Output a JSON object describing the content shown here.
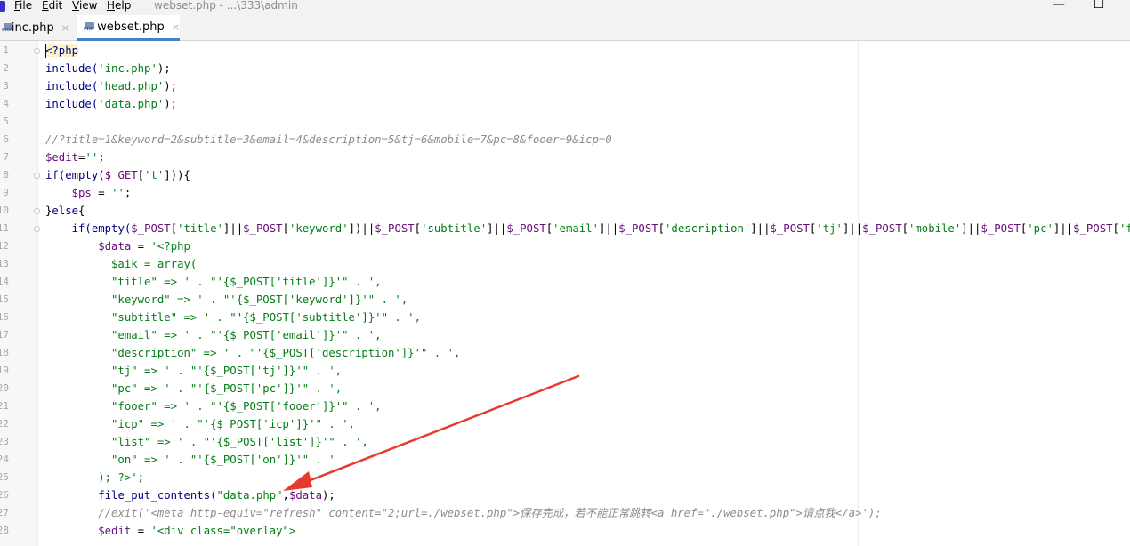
{
  "menubar": {
    "items": [
      "File",
      "Edit",
      "View",
      "Help"
    ],
    "title": "webset.php - ...\\333\\admin",
    "minimize": "—",
    "maximize": "☐"
  },
  "tabs": [
    {
      "label": "inc.php",
      "close": "×",
      "icon": "php-file-icon",
      "active": false
    },
    {
      "label": "webset.php",
      "close": "×",
      "icon": "php-file-icon",
      "active": true
    }
  ],
  "line_numbers": [
    "1",
    "2",
    "3",
    "4",
    "5",
    "6",
    "7",
    "8",
    "9",
    "10",
    "11",
    "12",
    "13",
    "14",
    "15",
    "16",
    "17",
    "18",
    "19",
    "20",
    "21",
    "22",
    "23",
    "24",
    "25",
    "26",
    "27",
    "28"
  ],
  "code": [
    [
      [
        "tag",
        "<?php"
      ]
    ],
    [
      [
        "k",
        "include("
      ],
      [
        "s",
        "'inc.php'"
      ],
      [
        "d",
        ");"
      ]
    ],
    [
      [
        "k",
        "include("
      ],
      [
        "s",
        "'head.php'"
      ],
      [
        "d",
        ");"
      ]
    ],
    [
      [
        "k",
        "include("
      ],
      [
        "s",
        "'data.php'"
      ],
      [
        "d",
        ");"
      ]
    ],
    [],
    [
      [
        "c",
        "//?title=1&keyword=2&subtitle=3&email=4&description=5&tj=6&mobile=7&pc=8&fooer=9&icp=0"
      ]
    ],
    [
      [
        "v",
        "$edit"
      ],
      [
        "d",
        "="
      ],
      [
        "s",
        "''"
      ],
      [
        "d",
        ";"
      ]
    ],
    [
      [
        "k",
        "if(empty("
      ],
      [
        "v",
        "$_GET"
      ],
      [
        "d",
        "["
      ],
      [
        "s",
        "'t'"
      ],
      [
        "d",
        "])){"
      ]
    ],
    [
      [
        "d",
        "    "
      ],
      [
        "v",
        "$ps"
      ],
      [
        "d",
        " = "
      ],
      [
        "s",
        "''"
      ],
      [
        "d",
        ";"
      ]
    ],
    [
      [
        "d",
        "}"
      ],
      [
        "k",
        "else"
      ],
      [
        "d",
        "{"
      ]
    ],
    [
      [
        "d",
        "    "
      ],
      [
        "k",
        "if(empty("
      ],
      [
        "v",
        "$_POST"
      ],
      [
        "d",
        "["
      ],
      [
        "s",
        "'title'"
      ],
      [
        "d",
        "]||"
      ],
      [
        "v",
        "$_POST"
      ],
      [
        "d",
        "["
      ],
      [
        "s",
        "'keyword'"
      ],
      [
        "d",
        "])||"
      ],
      [
        "v",
        "$_POST"
      ],
      [
        "d",
        "["
      ],
      [
        "s",
        "'subtitle'"
      ],
      [
        "d",
        "]||"
      ],
      [
        "v",
        "$_POST"
      ],
      [
        "d",
        "["
      ],
      [
        "s",
        "'email'"
      ],
      [
        "d",
        "]||"
      ],
      [
        "v",
        "$_POST"
      ],
      [
        "d",
        "["
      ],
      [
        "s",
        "'description'"
      ],
      [
        "d",
        "]||"
      ],
      [
        "v",
        "$_POST"
      ],
      [
        "d",
        "["
      ],
      [
        "s",
        "'tj'"
      ],
      [
        "d",
        "]||"
      ],
      [
        "v",
        "$_POST"
      ],
      [
        "d",
        "["
      ],
      [
        "s",
        "'mobile'"
      ],
      [
        "d",
        "]||"
      ],
      [
        "v",
        "$_POST"
      ],
      [
        "d",
        "["
      ],
      [
        "s",
        "'pc'"
      ],
      [
        "d",
        "]||"
      ],
      [
        "v",
        "$_POST"
      ],
      [
        "d",
        "["
      ],
      [
        "s",
        "'fooer'"
      ],
      [
        "d",
        "]"
      ]
    ],
    [
      [
        "d",
        "        "
      ],
      [
        "v",
        "$data"
      ],
      [
        "d",
        " = "
      ],
      [
        "s",
        "'<?php"
      ]
    ],
    [
      [
        "s",
        "          $aik = array("
      ]
    ],
    [
      [
        "s",
        "          \"title\" => ' . \"'{$_POST['title']}'\" . ',"
      ]
    ],
    [
      [
        "s",
        "          \"keyword\" => ' . \"'{$_POST['keyword']}'\" . ',"
      ]
    ],
    [
      [
        "s",
        "          \"subtitle\" => ' . \"'{$_POST['subtitle']}'\" . ',"
      ]
    ],
    [
      [
        "s",
        "          \"email\" => ' . \"'{$_POST['email']}'\" . ',"
      ]
    ],
    [
      [
        "s",
        "          \"description\" => ' . \"'{$_POST['description']}'\" . ',"
      ]
    ],
    [
      [
        "s",
        "          \"tj\" => ' . \"'{$_POST['tj']}'\" . ',"
      ]
    ],
    [
      [
        "s",
        "          \"pc\" => ' . \"'{$_POST['pc']}'\" . ',"
      ]
    ],
    [
      [
        "s",
        "          \"fooer\" => ' . \"'{$_POST['fooer']}'\" . ',"
      ]
    ],
    [
      [
        "s",
        "          \"icp\" => ' . \"'{$_POST['icp']}'\" . ',"
      ]
    ],
    [
      [
        "s",
        "          \"list\" => ' . \"'{$_POST['list']}'\" . ',"
      ]
    ],
    [
      [
        "s",
        "          \"on\" => ' . \"'{$_POST['on']}'\" . '"
      ]
    ],
    [
      [
        "s",
        "        ); ?>'"
      ],
      [
        "d",
        ";"
      ]
    ],
    [
      [
        "d",
        "        "
      ],
      [
        "k",
        "file_put_contents("
      ],
      [
        "s",
        "\"data.php\""
      ],
      [
        "d",
        ","
      ],
      [
        "v",
        "$data"
      ],
      [
        "d",
        ");"
      ]
    ],
    [
      [
        "d",
        "        "
      ],
      [
        "c",
        "//exit('<meta http-equiv=\"refresh\" content=\"2;url=./webset.php\">"
      ],
      [
        "cj",
        "保存完成，若不能正常跳转"
      ],
      [
        "c",
        "<a href=\"./webset.php\">"
      ],
      [
        "cj",
        "请点我"
      ],
      [
        "c",
        "</a>');"
      ]
    ],
    [
      [
        "d",
        "        "
      ],
      [
        "v",
        "$edit"
      ],
      [
        "d",
        " = "
      ],
      [
        "s",
        "'<div class=\"overlay\">"
      ]
    ]
  ],
  "annotation": {
    "color": "#e8392e",
    "label": "red-arrow"
  },
  "colors": {
    "keyword": "#000080",
    "string": "#067d17",
    "variable": "#660e7a",
    "comment": "#8c8c8c",
    "tab_accent": "#4083c9"
  }
}
